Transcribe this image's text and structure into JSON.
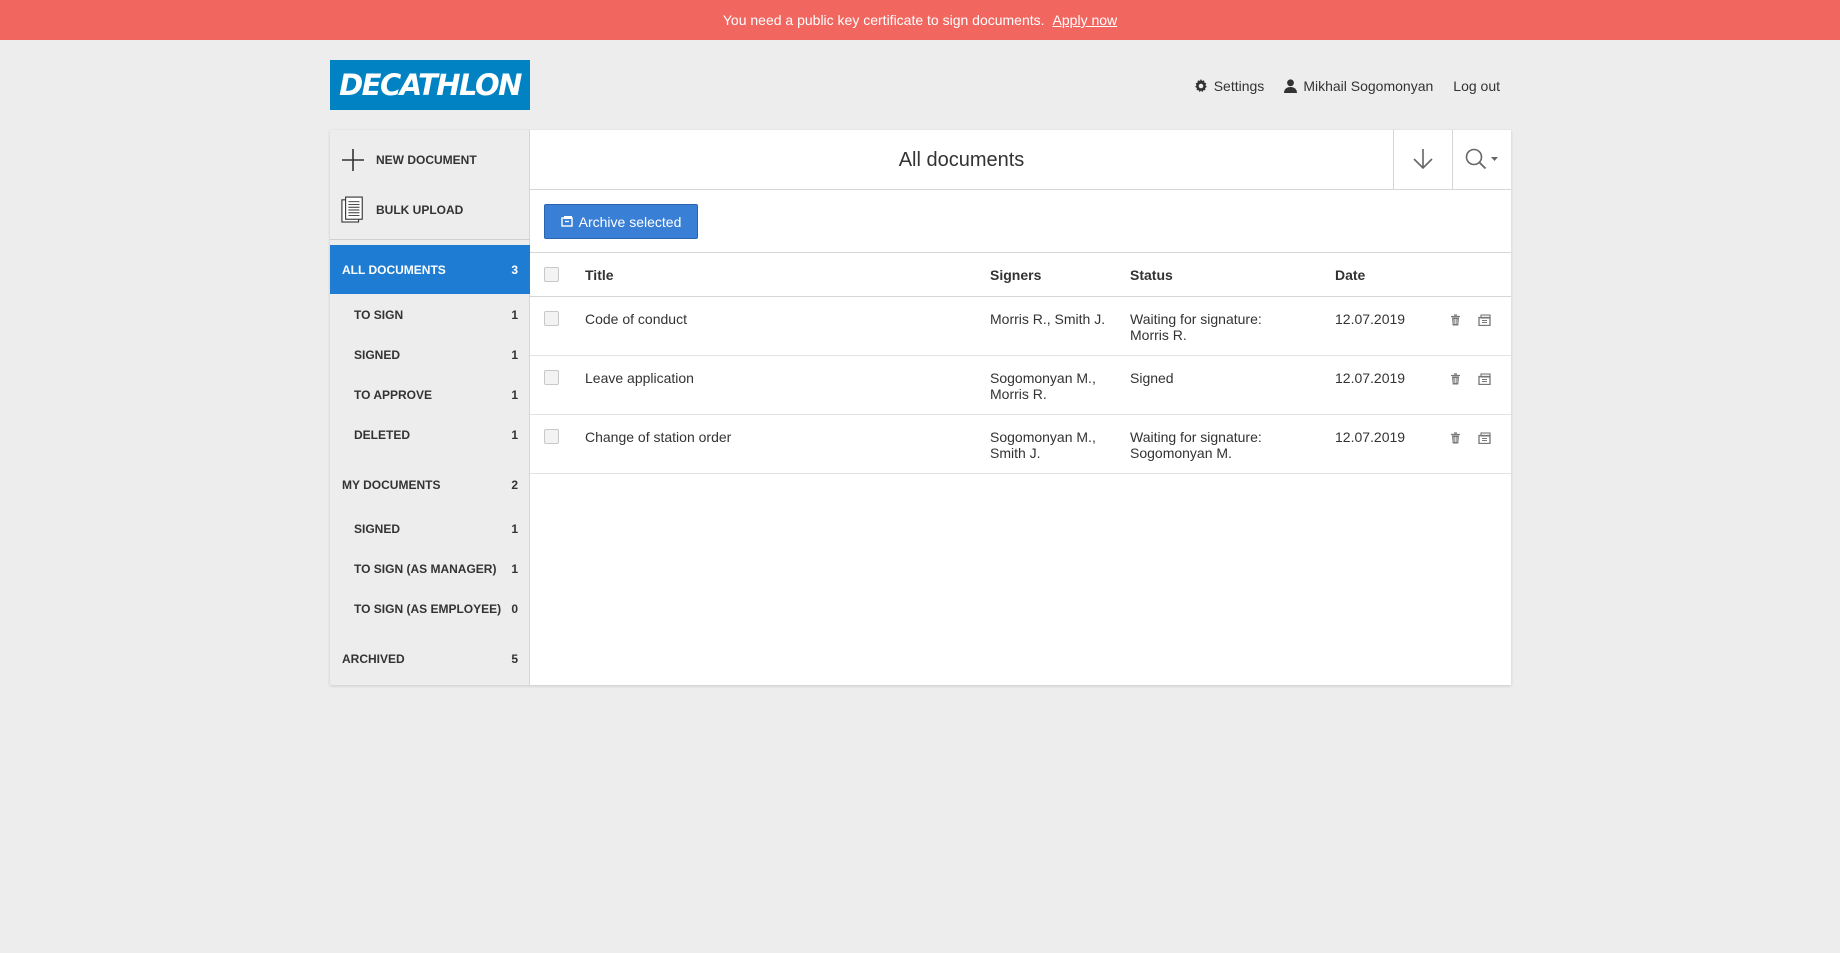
{
  "banner": {
    "message": "You need a public key certificate to sign documents.",
    "link": "Apply now",
    "color": "#f26660"
  },
  "logo": {
    "text": "DECATHLON",
    "color": "#0082c3"
  },
  "topnav": {
    "settings": "Settings",
    "user": "Mikhail Sogomonyan",
    "logout": "Log out"
  },
  "sidebar": {
    "new_document": "NEW DOCUMENT",
    "bulk_upload": "BULK UPLOAD",
    "groups": {
      "all": {
        "label": "ALL DOCUMENTS",
        "count": "3"
      },
      "to_sign": {
        "label": "TO SIGN",
        "count": "1"
      },
      "signed": {
        "label": "SIGNED",
        "count": "1"
      },
      "to_approve": {
        "label": "TO APPROVE",
        "count": "1"
      },
      "deleted": {
        "label": "DELETED",
        "count": "1"
      },
      "my": {
        "label": "MY DOCUMENTS",
        "count": "2"
      },
      "my_signed": {
        "label": "SIGNED",
        "count": "1"
      },
      "my_sign_manager": {
        "label": "TO SIGN (AS MANAGER)",
        "count": "1"
      },
      "my_sign_employee": {
        "label": "TO SIGN (AS EMPLOYEE)",
        "count": "0"
      },
      "archived": {
        "label": "ARCHIVED",
        "count": "5"
      }
    },
    "accent": "#1e7cd3"
  },
  "main": {
    "title": "All documents",
    "archive_button": "Archive selected",
    "columns": {
      "title": "Title",
      "signers": "Signers",
      "status": "Status",
      "date": "Date"
    },
    "rows": [
      {
        "title": "Code of conduct",
        "signers_1": "Morris R., Smith J.",
        "signers_2": "",
        "status_1": "Waiting for signature:",
        "status_2": "Morris R.",
        "date": "12.07.2019"
      },
      {
        "title": "Leave application",
        "signers_1": "Sogomonyan M.,",
        "signers_2": "Morris R.",
        "status_1": "Signed",
        "status_2": "",
        "date": "12.07.2019"
      },
      {
        "title": "Change of station order",
        "signers_1": "Sogomonyan M.,",
        "signers_2": "Smith J.",
        "status_1": "Waiting for signature:",
        "status_2": "Sogomonyan M.",
        "date": "12.07.2019"
      }
    ]
  }
}
